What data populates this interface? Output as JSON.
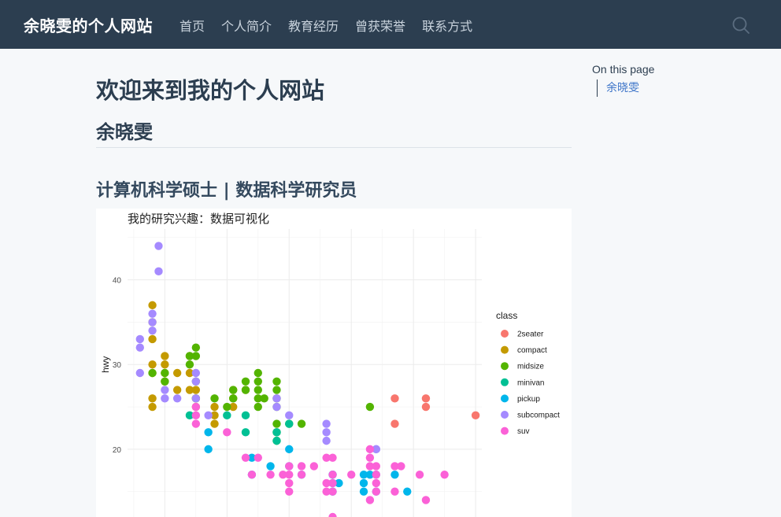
{
  "navbar": {
    "brand": "余晓雯的个人网站",
    "links": [
      "首页",
      "个人简介",
      "教育经历",
      "曾获荣誉",
      "联系方式"
    ]
  },
  "content": {
    "title": "欢迎来到我的个人网站",
    "name": "余晓雯",
    "subtitle": "计算机科学硕士 | 数据科学研究员"
  },
  "toc": {
    "title": "On this page",
    "items": [
      "余晓雯"
    ]
  },
  "chart_data": {
    "type": "scatter",
    "title": "我的研究兴趣：数据可视化",
    "xlabel": "",
    "ylabel": "hwy",
    "yticks": [
      20,
      30,
      40
    ],
    "ylim": [
      12,
      46
    ],
    "xlim": [
      1.4,
      7.1
    ],
    "grid": true,
    "legend": {
      "title": "class",
      "position": "right",
      "entries": [
        {
          "name": "2seater",
          "color": "#F8766D"
        },
        {
          "name": "compact",
          "color": "#C49A00"
        },
        {
          "name": "midsize",
          "color": "#53B400"
        },
        {
          "name": "minivan",
          "color": "#00C094"
        },
        {
          "name": "pickup",
          "color": "#00B6EB"
        },
        {
          "name": "subcompact",
          "color": "#A58AFF"
        },
        {
          "name": "suv",
          "color": "#FB61D7"
        }
      ]
    },
    "series": [
      {
        "name": "2seater",
        "points": [
          [
            5.7,
            26
          ],
          [
            5.7,
            23
          ],
          [
            6.2,
            26
          ],
          [
            6.2,
            25
          ],
          [
            7.0,
            24
          ]
        ]
      },
      {
        "name": "compact",
        "points": [
          [
            1.8,
            29
          ],
          [
            1.8,
            30
          ],
          [
            1.8,
            33
          ],
          [
            1.8,
            35
          ],
          [
            1.8,
            37
          ],
          [
            1.8,
            26
          ],
          [
            1.8,
            25
          ],
          [
            2.0,
            31
          ],
          [
            2.0,
            28
          ],
          [
            2.0,
            30
          ],
          [
            2.0,
            29
          ],
          [
            2.2,
            27
          ],
          [
            2.2,
            29
          ],
          [
            2.4,
            31
          ],
          [
            2.4,
            29
          ],
          [
            2.4,
            27
          ],
          [
            2.5,
            27
          ],
          [
            2.5,
            25
          ],
          [
            2.5,
            26
          ],
          [
            2.8,
            25
          ],
          [
            2.8,
            24
          ],
          [
            2.8,
            23
          ],
          [
            3.1,
            26
          ],
          [
            3.1,
            25
          ],
          [
            3.1,
            27
          ],
          [
            3.3,
            27
          ]
        ]
      },
      {
        "name": "midsize",
        "points": [
          [
            1.8,
            29
          ],
          [
            2.0,
            29
          ],
          [
            2.0,
            28
          ],
          [
            2.4,
            30
          ],
          [
            2.4,
            31
          ],
          [
            2.5,
            32
          ],
          [
            2.5,
            31
          ],
          [
            2.5,
            28
          ],
          [
            2.5,
            26
          ],
          [
            2.8,
            26
          ],
          [
            3.0,
            25
          ],
          [
            3.1,
            27
          ],
          [
            3.1,
            26
          ],
          [
            3.3,
            28
          ],
          [
            3.3,
            27
          ],
          [
            3.5,
            29
          ],
          [
            3.5,
            28
          ],
          [
            3.5,
            27
          ],
          [
            3.5,
            26
          ],
          [
            3.5,
            25
          ],
          [
            3.6,
            26
          ],
          [
            3.8,
            28
          ],
          [
            3.8,
            26
          ],
          [
            3.8,
            27
          ],
          [
            3.8,
            25
          ],
          [
            3.8,
            23
          ],
          [
            3.8,
            22
          ],
          [
            3.8,
            21
          ],
          [
            4.0,
            23
          ],
          [
            4.2,
            23
          ],
          [
            5.3,
            25
          ]
        ]
      },
      {
        "name": "minivan",
        "points": [
          [
            2.4,
            24
          ],
          [
            3.0,
            24
          ],
          [
            3.3,
            24
          ],
          [
            3.3,
            22
          ],
          [
            3.8,
            22
          ],
          [
            3.8,
            21
          ],
          [
            4.0,
            23
          ]
        ]
      },
      {
        "name": "pickup",
        "points": [
          [
            2.7,
            22
          ],
          [
            2.7,
            20
          ],
          [
            3.4,
            19
          ],
          [
            3.4,
            17
          ],
          [
            3.7,
            18
          ],
          [
            4.0,
            20
          ],
          [
            4.0,
            18
          ],
          [
            4.2,
            17
          ],
          [
            4.7,
            17
          ],
          [
            4.7,
            16
          ],
          [
            4.7,
            15
          ],
          [
            4.8,
            16
          ],
          [
            5.2,
            17
          ],
          [
            5.2,
            16
          ],
          [
            5.2,
            15
          ],
          [
            5.4,
            15
          ],
          [
            5.7,
            17
          ],
          [
            5.9,
            15
          ],
          [
            4.7,
            17
          ],
          [
            5.4,
            17
          ],
          [
            5.3,
            17
          ]
        ]
      },
      {
        "name": "subcompact",
        "points": [
          [
            1.6,
            33
          ],
          [
            1.6,
            32
          ],
          [
            1.6,
            29
          ],
          [
            1.9,
            44
          ],
          [
            1.9,
            41
          ],
          [
            1.8,
            36
          ],
          [
            1.8,
            34
          ],
          [
            1.8,
            35
          ],
          [
            2.0,
            27
          ],
          [
            2.0,
            26
          ],
          [
            2.2,
            26
          ],
          [
            2.5,
            29
          ],
          [
            2.5,
            28
          ],
          [
            2.5,
            26
          ],
          [
            2.7,
            24
          ],
          [
            3.8,
            26
          ],
          [
            3.8,
            25
          ],
          [
            4.0,
            24
          ],
          [
            4.6,
            23
          ],
          [
            4.6,
            22
          ],
          [
            4.6,
            21
          ],
          [
            5.4,
            20
          ],
          [
            5.4,
            20
          ]
        ]
      },
      {
        "name": "suv",
        "points": [
          [
            2.5,
            23
          ],
          [
            2.5,
            24
          ],
          [
            2.5,
            25
          ],
          [
            3.0,
            22
          ],
          [
            3.3,
            19
          ],
          [
            3.4,
            17
          ],
          [
            3.5,
            19
          ],
          [
            3.7,
            17
          ],
          [
            3.9,
            17
          ],
          [
            4.0,
            18
          ],
          [
            4.0,
            17
          ],
          [
            4.0,
            16
          ],
          [
            4.0,
            15
          ],
          [
            4.2,
            17
          ],
          [
            4.2,
            18
          ],
          [
            4.4,
            18
          ],
          [
            4.6,
            16
          ],
          [
            4.6,
            15
          ],
          [
            4.6,
            19
          ],
          [
            4.7,
            17
          ],
          [
            4.7,
            16
          ],
          [
            4.7,
            15
          ],
          [
            4.7,
            12
          ],
          [
            4.7,
            19
          ],
          [
            5.0,
            17
          ],
          [
            5.3,
            20
          ],
          [
            5.3,
            19
          ],
          [
            5.3,
            18
          ],
          [
            5.3,
            14
          ],
          [
            5.4,
            18
          ],
          [
            5.4,
            17
          ],
          [
            5.4,
            16
          ],
          [
            5.4,
            15
          ],
          [
            5.7,
            18
          ],
          [
            5.8,
            18
          ],
          [
            5.7,
            15
          ],
          [
            6.1,
            17
          ],
          [
            6.2,
            14
          ],
          [
            6.5,
            17
          ]
        ]
      }
    ]
  }
}
